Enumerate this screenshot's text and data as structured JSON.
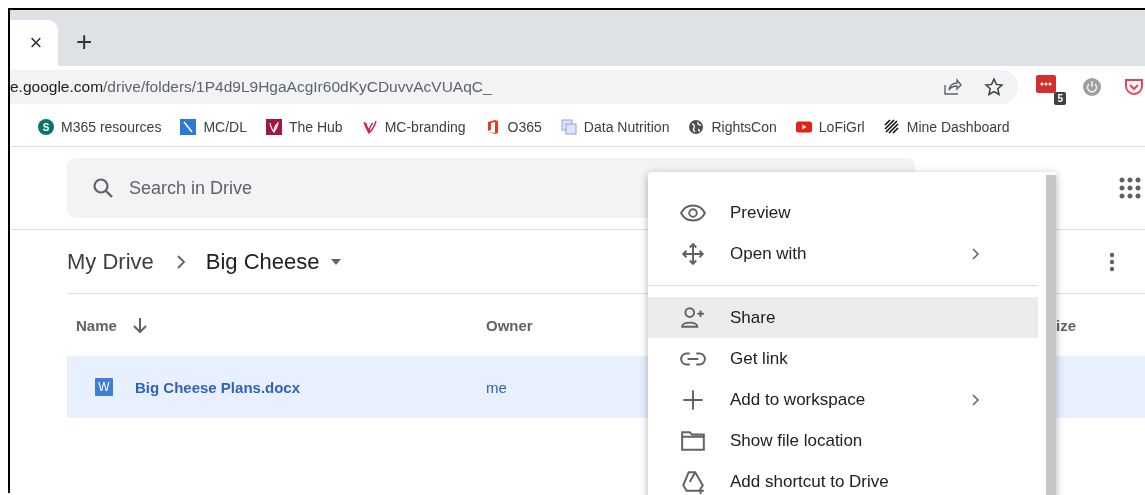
{
  "browser": {
    "tab": {
      "close": "×"
    },
    "new_tab": "+",
    "address": {
      "host": "e.google.com",
      "path": "/drive/folders/1P4d9L9HgaAcgIr60dKyCDuvvAcVUAqC_"
    },
    "extensions": [
      {
        "kind": "counter",
        "badge": "5"
      },
      {
        "kind": "power"
      },
      {
        "kind": "pocket"
      }
    ],
    "bookmarks": [
      {
        "label": "M365 resources",
        "kind": "letter",
        "icon_letter": "S"
      },
      {
        "label": "MC/DL",
        "kind": "slash"
      },
      {
        "label": "The Hub",
        "kind": "leafbox"
      },
      {
        "label": "MC-branding",
        "kind": "leaf"
      },
      {
        "label": "O365",
        "kind": "office"
      },
      {
        "label": "Data Nutrition",
        "kind": "layers"
      },
      {
        "label": "RightsCon",
        "kind": "globe"
      },
      {
        "label": "LoFiGrl",
        "kind": "play"
      },
      {
        "label": "Mine Dashboard",
        "kind": "stripes"
      }
    ]
  },
  "drive": {
    "search": {
      "placeholder": "Search in Drive"
    },
    "breadcrumb": [
      {
        "label": "My Drive",
        "current": false
      },
      {
        "label": "Big Cheese",
        "current": true
      }
    ],
    "columns": [
      {
        "label": "Name",
        "sorted": true
      },
      {
        "label": "Owner",
        "sorted": false
      },
      {
        "label": "ize",
        "sorted": false
      }
    ],
    "rows": [
      {
        "name": "Big Cheese Plans.docx",
        "type_letter": "W",
        "owner": "me",
        "selected": true
      }
    ]
  },
  "context_menu": {
    "groups": [
      [
        {
          "label": "Preview",
          "kind": "preview",
          "submenu": false,
          "selected": false
        },
        {
          "label": "Open with",
          "kind": "open",
          "submenu": true,
          "selected": false
        }
      ],
      [
        {
          "label": "Share",
          "kind": "share",
          "submenu": false,
          "selected": true
        },
        {
          "label": "Get link",
          "kind": "link",
          "submenu": false,
          "selected": false
        },
        {
          "label": "Add to workspace",
          "kind": "add",
          "submenu": true,
          "selected": false
        },
        {
          "label": "Show file location",
          "kind": "location",
          "submenu": false,
          "selected": false
        },
        {
          "label": "Add shortcut to Drive",
          "kind": "shortcut",
          "submenu": false,
          "selected": false
        }
      ]
    ]
  }
}
